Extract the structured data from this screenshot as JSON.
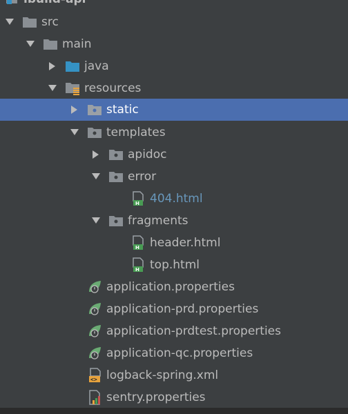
{
  "project_tree": {
    "root": {
      "label": "ibuild-api"
    },
    "src": {
      "label": "src"
    },
    "main": {
      "label": "main"
    },
    "java": {
      "label": "java"
    },
    "resources": {
      "label": "resources"
    },
    "static": {
      "label": "static"
    },
    "templates": {
      "label": "templates"
    },
    "apidoc": {
      "label": "apidoc"
    },
    "error": {
      "label": "error"
    },
    "file_404": {
      "label": "404.html"
    },
    "fragments": {
      "label": "fragments"
    },
    "file_header": {
      "label": "header.html"
    },
    "file_top": {
      "label": "top.html"
    },
    "app_props": {
      "label": "application.properties"
    },
    "app_prd_props": {
      "label": "application-prd.properties"
    },
    "app_prdtest_props": {
      "label": "application-prdtest.properties"
    },
    "app_qc_props": {
      "label": "application-qc.properties"
    },
    "logback": {
      "label": "logback-spring.xml"
    },
    "sentry": {
      "label": "sentry.properties"
    }
  },
  "colors": {
    "background": "#3c3f41",
    "selection": "#4b6eaf",
    "text": "#bbbbbb",
    "modified_html": "#6897bb"
  }
}
